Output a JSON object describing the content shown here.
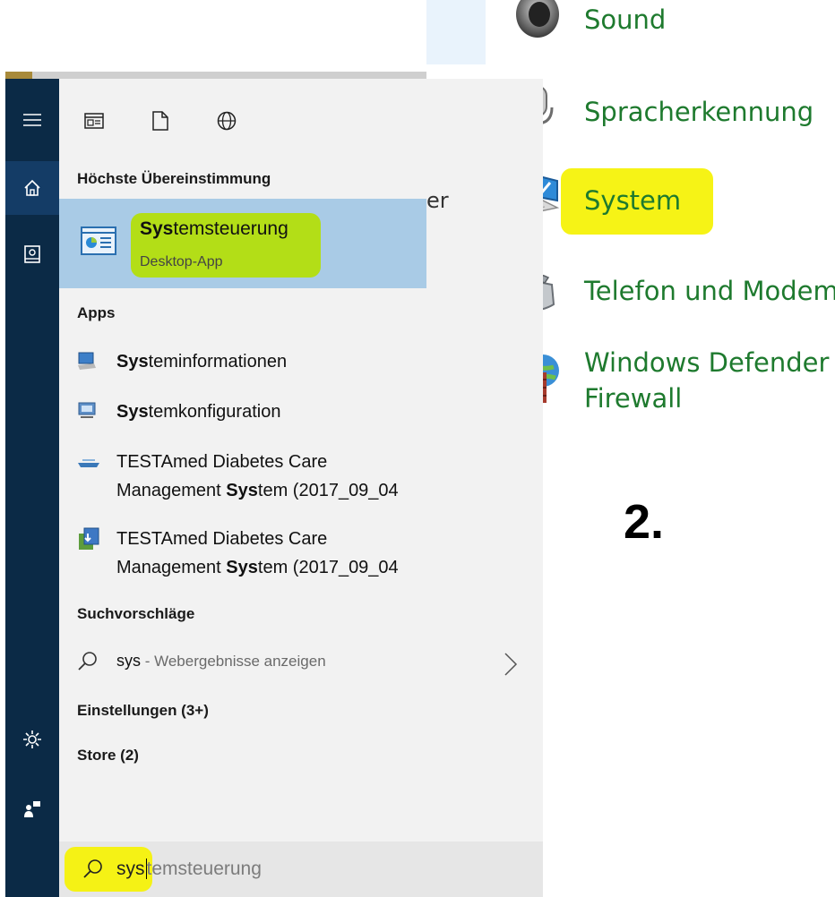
{
  "control_panel": {
    "items": [
      {
        "label": "Sound",
        "icon": "speaker-icon"
      },
      {
        "label": "Spracherkennung",
        "icon": "microphone-icon"
      },
      {
        "label": "System",
        "icon": "computer-icon",
        "highlighted": true
      },
      {
        "label": "Telefon und Modem",
        "icon": "telephone-icon"
      },
      {
        "label": "Windows Defender",
        "label2": "Firewall",
        "icon": "firewall-icon"
      }
    ],
    "step_number": "2."
  },
  "start_menu": {
    "rail": [
      "hamburger-icon",
      "home-icon",
      "notebook-icon",
      "settings-gear-icon",
      "feedback-icon"
    ],
    "filters": [
      "apps-filter-icon",
      "documents-filter-icon",
      "web-filter-icon"
    ],
    "peek_text": "er",
    "best_match": {
      "header": "Höchste Übereinstimmung",
      "name_bold": "Sys",
      "name_rest": "temsteuerung",
      "subtitle": "Desktop-App"
    },
    "apps": {
      "header": "Apps",
      "items": [
        {
          "line1_bold": "Sys",
          "line1_rest": "teminformationen",
          "line2": "",
          "icon": "system-info-icon"
        },
        {
          "line1_bold": "Sys",
          "line1_rest": "temkonfiguration",
          "line2": "",
          "icon": "system-config-icon"
        },
        {
          "line1": "TESTAmed Diabetes Care",
          "line2_pre": "Management ",
          "line2_bold": "Sys",
          "line2_rest": "tem (2017_09_04",
          "icon": "testamed-device-icon"
        },
        {
          "line1": "TESTAmed Diabetes Care",
          "line2_pre": "Management ",
          "line2_bold": "Sys",
          "line2_rest": "tem (2017_09_04",
          "icon": "installer-icon"
        }
      ]
    },
    "suggestions": {
      "header": "Suchvorschläge",
      "query": "sys",
      "separator": " - ",
      "action": "Webergebnisse anzeigen"
    },
    "settings_header": "Einstellungen (3+)",
    "store_header": "Store (2)",
    "search": {
      "typed": "sys",
      "placeholder_rest": "temsteuerung"
    }
  },
  "colors": {
    "highlight": "#f6f20a",
    "link_green": "#1e7a2e",
    "rail_bg": "#0b2a46",
    "selected_bg": "#a9cbe6"
  }
}
